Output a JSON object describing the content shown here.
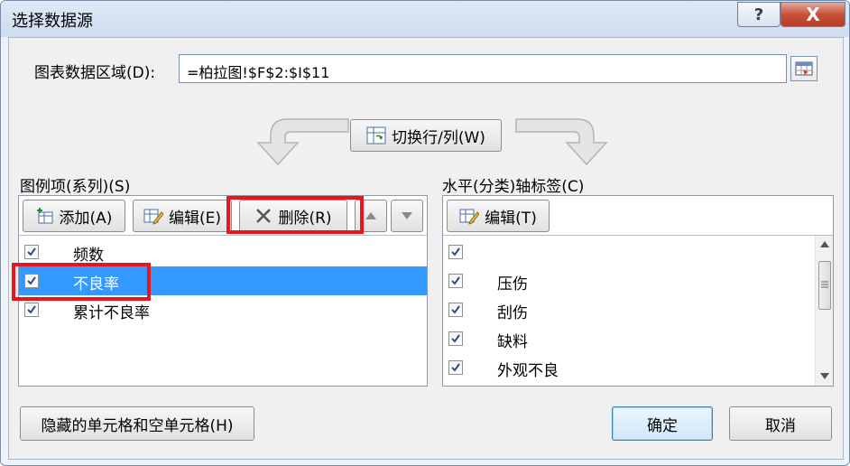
{
  "window": {
    "title": "选择数据源",
    "help_label": "?",
    "close_label": "X"
  },
  "data_range": {
    "label": "图表数据区域(D):",
    "value": "=柏拉图!$F$2:$I$11"
  },
  "switch_button": {
    "label": "切换行/列(W)"
  },
  "legend": {
    "label": "图例项(系列)(S)",
    "add_label": "添加(A)",
    "edit_label": "编辑(E)",
    "delete_label": "删除(R)",
    "items": [
      {
        "label": "频数",
        "checked": true,
        "selected": false
      },
      {
        "label": "不良率",
        "checked": true,
        "selected": true
      },
      {
        "label": "累计不良率",
        "checked": true,
        "selected": false
      }
    ]
  },
  "axis": {
    "label": "水平(分类)轴标签(C)",
    "edit_label": "编辑(T)",
    "items": [
      {
        "label": "",
        "checked": true
      },
      {
        "label": "压伤",
        "checked": true
      },
      {
        "label": "刮伤",
        "checked": true
      },
      {
        "label": "缺料",
        "checked": true
      },
      {
        "label": "外观不良",
        "checked": true
      }
    ]
  },
  "footer": {
    "hidden_cells_label": "隐藏的单元格和空单元格(H)",
    "ok_label": "确定",
    "cancel_label": "取消"
  },
  "colors": {
    "highlight": "#e8141e",
    "selection": "#3399ff"
  }
}
